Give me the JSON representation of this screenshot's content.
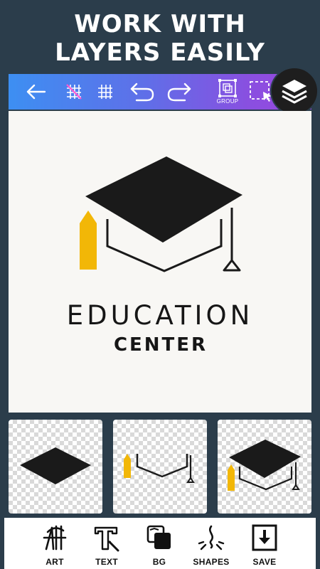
{
  "headline": {
    "line1": "WORK WITH",
    "line2": "LAYERS EASILY"
  },
  "toolbar": {
    "back_icon": "arrow-left-icon",
    "grid_off_icon": "grid-off-icon",
    "grid_icon": "grid-icon",
    "undo_icon": "undo-icon",
    "redo_icon": "redo-icon",
    "group_label": "GROUP",
    "group_icon": "group-icon",
    "select_icon": "selection-icon"
  },
  "layers_icon": "layers-icon",
  "canvas": {
    "title": "EDUCATION",
    "subtitle": "CENTER",
    "logo_icon": "graduation-cap-icon",
    "colors": {
      "ink": "#1a1a1a",
      "accent": "#f2b707",
      "background": "#f8f7f4"
    }
  },
  "layers": [
    {
      "name": "cap-top-layer"
    },
    {
      "name": "cap-base-with-pencil-layer"
    },
    {
      "name": "full-cap-layer"
    }
  ],
  "bottom_nav": [
    {
      "label": "ART",
      "icon": "art-icon"
    },
    {
      "label": "TEXT",
      "icon": "text-icon"
    },
    {
      "label": "BG",
      "icon": "background-icon"
    },
    {
      "label": "SHAPES",
      "icon": "shapes-icon"
    },
    {
      "label": "SAVE",
      "icon": "save-icon"
    }
  ]
}
